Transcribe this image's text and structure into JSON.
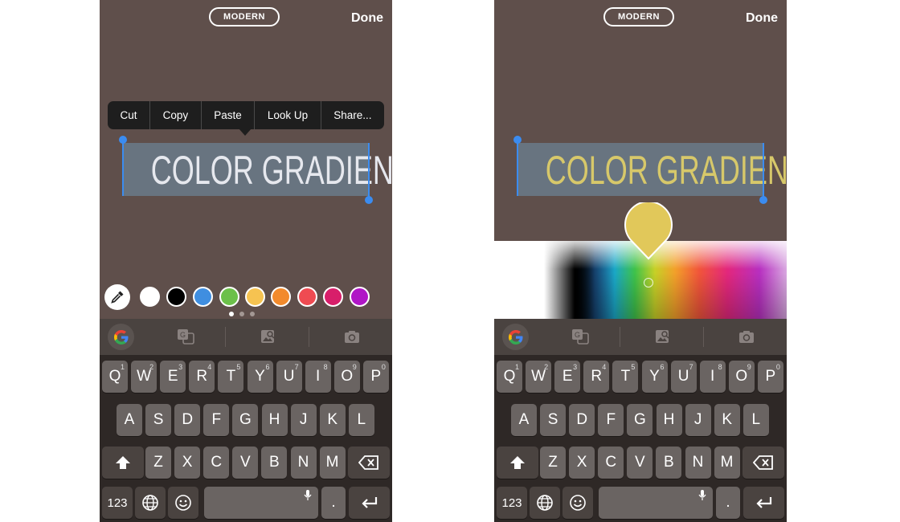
{
  "screens": [
    {
      "style_label": "MODERN",
      "done_label": "Done",
      "text": "COLOR GRADIENT",
      "text_color": "#e6e8ee",
      "context_menu": [
        "Cut",
        "Copy",
        "Paste",
        "Look Up",
        "Share..."
      ],
      "swatches": [
        "#ffffff",
        "#000000",
        "#3f8ee0",
        "#6cc04a",
        "#f6c351",
        "#f28a2c",
        "#ef4b52",
        "#d81e6a",
        "#b016c6"
      ]
    },
    {
      "style_label": "MODERN",
      "done_label": "Done",
      "text": "COLOR GRADIENT",
      "text_color": "#d7c86a",
      "selected_color": "#e1c85a"
    }
  ],
  "keyboard": {
    "row1": [
      "Q",
      "W",
      "E",
      "R",
      "T",
      "Y",
      "U",
      "I",
      "O",
      "P"
    ],
    "row1_hints": [
      "1",
      "2",
      "3",
      "4",
      "5",
      "6",
      "7",
      "8",
      "9",
      "0"
    ],
    "row2": [
      "A",
      "S",
      "D",
      "F",
      "G",
      "H",
      "J",
      "K",
      "L"
    ],
    "row3": [
      "Z",
      "X",
      "C",
      "V",
      "B",
      "N",
      "M"
    ],
    "numbers_key": "123",
    "period_key": ".",
    "suggestion_icons": [
      "google-logo-icon",
      "translate-icon",
      "image-search-icon",
      "camera-icon"
    ]
  }
}
